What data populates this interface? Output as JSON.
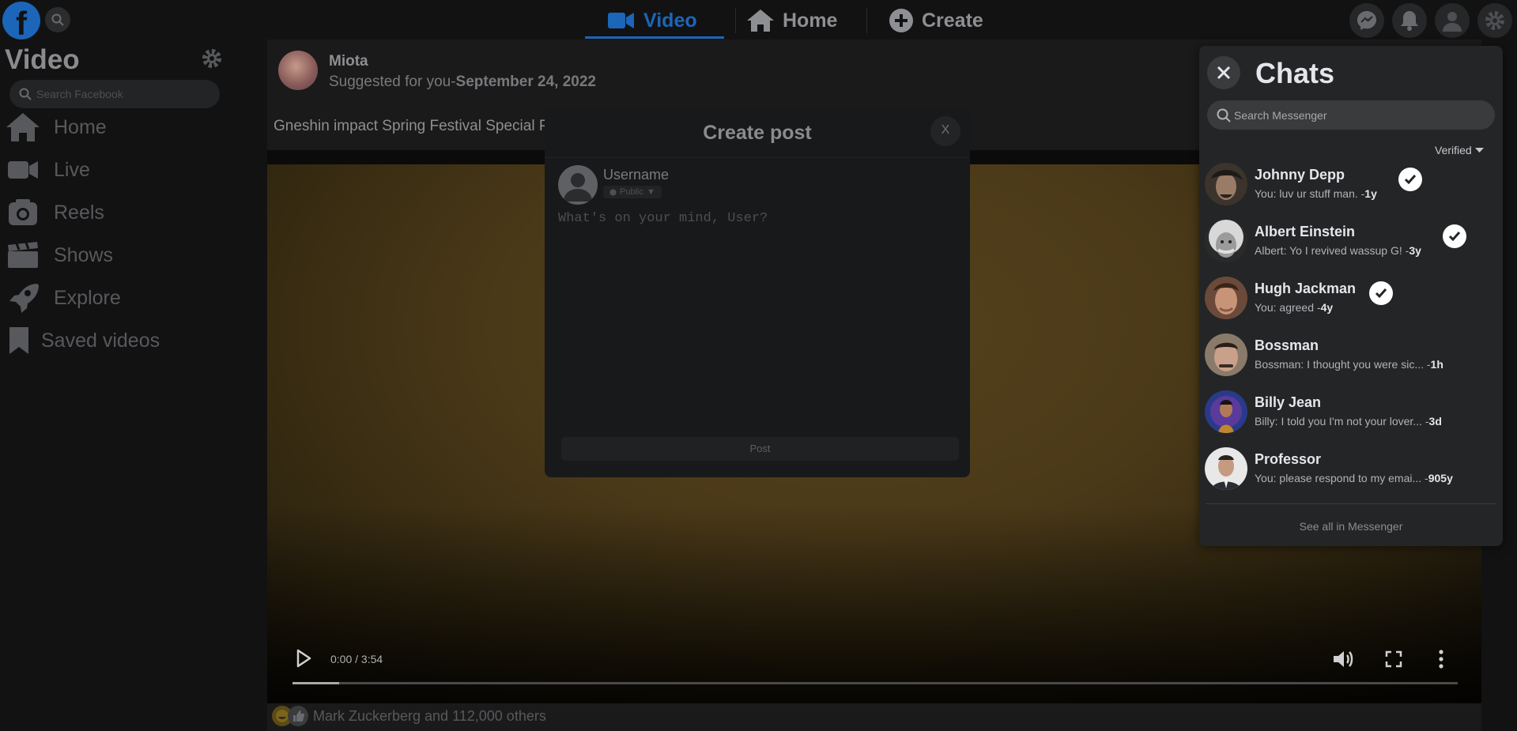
{
  "topnav": {
    "logo_letter": "f",
    "tabs": [
      {
        "label": "Video",
        "icon": "video-camera-icon",
        "active": true
      },
      {
        "label": "Home",
        "icon": "home-icon",
        "active": false
      },
      {
        "label": "Create",
        "icon": "plus-circle-icon",
        "active": false
      }
    ],
    "right_icons": [
      "messenger-icon",
      "bell-icon",
      "profile-icon",
      "gear-icon"
    ]
  },
  "sidebar": {
    "title": "Video",
    "search_placeholder": "Search Facebook",
    "items": [
      {
        "label": "Home",
        "icon": "home-icon"
      },
      {
        "label": "Live",
        "icon": "live-camera-icon"
      },
      {
        "label": "Reels",
        "icon": "reels-icon"
      },
      {
        "label": "Shows",
        "icon": "clapperboard-icon"
      },
      {
        "label": "Explore",
        "icon": "rocket-icon"
      },
      {
        "label": "Saved videos",
        "icon": "bookmark-icon"
      }
    ]
  },
  "post": {
    "author": "Miota",
    "meta_prefix": "Suggested for you-",
    "date": "September 24, 2022",
    "text": "Gneshin impact Spring Festival Special Pr",
    "video": {
      "time": "0:00 / 3:54",
      "progress": 0.04
    },
    "reactions_text": "Mark Zuckerberg and 112,000 others"
  },
  "modal": {
    "title": "Create post",
    "close_label": "X",
    "username": "Username",
    "privacy": "Public",
    "placeholder": "What's on your mind, User?",
    "post_label": "Post"
  },
  "chats": {
    "title": "Chats",
    "search_placeholder": "Search Messenger",
    "filter_label": "Verified",
    "see_all": "See all in Messenger",
    "items": [
      {
        "name": "Johnny Depp",
        "preview": "You: luv ur stuff man. -",
        "time": "1y",
        "verified": true
      },
      {
        "name": "Albert Einstein",
        "preview": "Albert: Yo I revived wassup G! -",
        "time": "3y",
        "verified": true
      },
      {
        "name": "Hugh Jackman",
        "preview": "You: agreed -",
        "time": "4y",
        "verified": true
      },
      {
        "name": "Bossman",
        "preview": "Bossman: I thought you were sic... -",
        "time": "1h",
        "verified": false
      },
      {
        "name": "Billy Jean",
        "preview": "Billy: I told you I'm not your lover... -",
        "time": "3d",
        "verified": false
      },
      {
        "name": "Professor",
        "preview": "You: please respond to my emai... -",
        "time": "905y",
        "verified": false
      }
    ]
  },
  "colors": {
    "accent": "#1b66b8",
    "panel": "#242526",
    "text_primary": "#e4e6eb",
    "text_secondary": "#b0b3b8"
  }
}
